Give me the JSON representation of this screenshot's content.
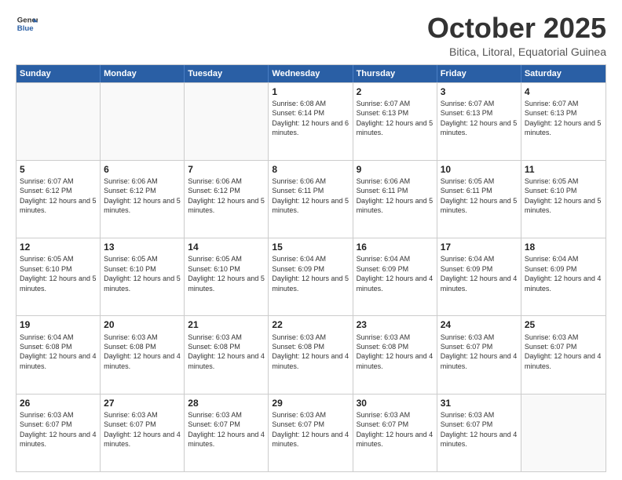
{
  "logo": {
    "general": "General",
    "blue": "Blue"
  },
  "header": {
    "month": "October 2025",
    "location": "Bitica, Litoral, Equatorial Guinea"
  },
  "weekdays": [
    "Sunday",
    "Monday",
    "Tuesday",
    "Wednesday",
    "Thursday",
    "Friday",
    "Saturday"
  ],
  "rows": [
    [
      {
        "day": "",
        "info": "",
        "empty": true
      },
      {
        "day": "",
        "info": "",
        "empty": true
      },
      {
        "day": "",
        "info": "",
        "empty": true
      },
      {
        "day": "1",
        "info": "Sunrise: 6:08 AM\nSunset: 6:14 PM\nDaylight: 12 hours\nand 6 minutes."
      },
      {
        "day": "2",
        "info": "Sunrise: 6:07 AM\nSunset: 6:13 PM\nDaylight: 12 hours\nand 5 minutes."
      },
      {
        "day": "3",
        "info": "Sunrise: 6:07 AM\nSunset: 6:13 PM\nDaylight: 12 hours\nand 5 minutes."
      },
      {
        "day": "4",
        "info": "Sunrise: 6:07 AM\nSunset: 6:13 PM\nDaylight: 12 hours\nand 5 minutes."
      }
    ],
    [
      {
        "day": "5",
        "info": "Sunrise: 6:07 AM\nSunset: 6:12 PM\nDaylight: 12 hours\nand 5 minutes."
      },
      {
        "day": "6",
        "info": "Sunrise: 6:06 AM\nSunset: 6:12 PM\nDaylight: 12 hours\nand 5 minutes."
      },
      {
        "day": "7",
        "info": "Sunrise: 6:06 AM\nSunset: 6:12 PM\nDaylight: 12 hours\nand 5 minutes."
      },
      {
        "day": "8",
        "info": "Sunrise: 6:06 AM\nSunset: 6:11 PM\nDaylight: 12 hours\nand 5 minutes."
      },
      {
        "day": "9",
        "info": "Sunrise: 6:06 AM\nSunset: 6:11 PM\nDaylight: 12 hours\nand 5 minutes."
      },
      {
        "day": "10",
        "info": "Sunrise: 6:05 AM\nSunset: 6:11 PM\nDaylight: 12 hours\nand 5 minutes."
      },
      {
        "day": "11",
        "info": "Sunrise: 6:05 AM\nSunset: 6:10 PM\nDaylight: 12 hours\nand 5 minutes."
      }
    ],
    [
      {
        "day": "12",
        "info": "Sunrise: 6:05 AM\nSunset: 6:10 PM\nDaylight: 12 hours\nand 5 minutes."
      },
      {
        "day": "13",
        "info": "Sunrise: 6:05 AM\nSunset: 6:10 PM\nDaylight: 12 hours\nand 5 minutes."
      },
      {
        "day": "14",
        "info": "Sunrise: 6:05 AM\nSunset: 6:10 PM\nDaylight: 12 hours\nand 5 minutes."
      },
      {
        "day": "15",
        "info": "Sunrise: 6:04 AM\nSunset: 6:09 PM\nDaylight: 12 hours\nand 5 minutes."
      },
      {
        "day": "16",
        "info": "Sunrise: 6:04 AM\nSunset: 6:09 PM\nDaylight: 12 hours\nand 4 minutes."
      },
      {
        "day": "17",
        "info": "Sunrise: 6:04 AM\nSunset: 6:09 PM\nDaylight: 12 hours\nand 4 minutes."
      },
      {
        "day": "18",
        "info": "Sunrise: 6:04 AM\nSunset: 6:09 PM\nDaylight: 12 hours\nand 4 minutes."
      }
    ],
    [
      {
        "day": "19",
        "info": "Sunrise: 6:04 AM\nSunset: 6:08 PM\nDaylight: 12 hours\nand 4 minutes."
      },
      {
        "day": "20",
        "info": "Sunrise: 6:03 AM\nSunset: 6:08 PM\nDaylight: 12 hours\nand 4 minutes."
      },
      {
        "day": "21",
        "info": "Sunrise: 6:03 AM\nSunset: 6:08 PM\nDaylight: 12 hours\nand 4 minutes."
      },
      {
        "day": "22",
        "info": "Sunrise: 6:03 AM\nSunset: 6:08 PM\nDaylight: 12 hours\nand 4 minutes."
      },
      {
        "day": "23",
        "info": "Sunrise: 6:03 AM\nSunset: 6:08 PM\nDaylight: 12 hours\nand 4 minutes."
      },
      {
        "day": "24",
        "info": "Sunrise: 6:03 AM\nSunset: 6:07 PM\nDaylight: 12 hours\nand 4 minutes."
      },
      {
        "day": "25",
        "info": "Sunrise: 6:03 AM\nSunset: 6:07 PM\nDaylight: 12 hours\nand 4 minutes."
      }
    ],
    [
      {
        "day": "26",
        "info": "Sunrise: 6:03 AM\nSunset: 6:07 PM\nDaylight: 12 hours\nand 4 minutes."
      },
      {
        "day": "27",
        "info": "Sunrise: 6:03 AM\nSunset: 6:07 PM\nDaylight: 12 hours\nand 4 minutes."
      },
      {
        "day": "28",
        "info": "Sunrise: 6:03 AM\nSunset: 6:07 PM\nDaylight: 12 hours\nand 4 minutes."
      },
      {
        "day": "29",
        "info": "Sunrise: 6:03 AM\nSunset: 6:07 PM\nDaylight: 12 hours\nand 4 minutes."
      },
      {
        "day": "30",
        "info": "Sunrise: 6:03 AM\nSunset: 6:07 PM\nDaylight: 12 hours\nand 4 minutes."
      },
      {
        "day": "31",
        "info": "Sunrise: 6:03 AM\nSunset: 6:07 PM\nDaylight: 12 hours\nand 4 minutes."
      },
      {
        "day": "",
        "info": "",
        "empty": true
      }
    ]
  ]
}
